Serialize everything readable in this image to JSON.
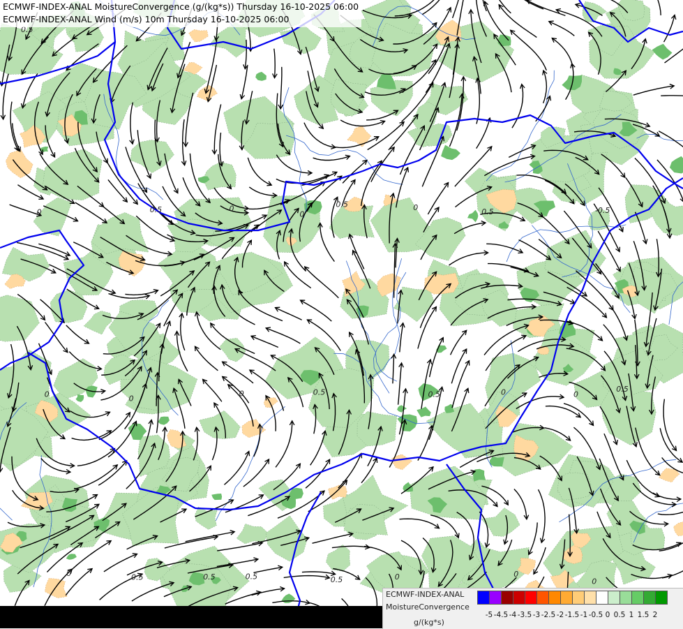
{
  "titles": {
    "line1": "ECMWF-INDEX-ANAL MoistureConvergence (g/(kg*s)) Thursday 16-10-2025 06:00",
    "line2": "ECMWF-INDEX-ANAL Wind (m/s) 10m Thursday 16-10-2025 06:00"
  },
  "legend": {
    "model": "ECMWF-INDEX-ANAL",
    "parameter": "MoistureConvergence",
    "unit": "g/(kg*s)",
    "swatch_colors": [
      "#0000ff",
      "#9900ff",
      "#990000",
      "#cc0000",
      "#ff0000",
      "#ff5500",
      "#ff8800",
      "#ffaa33",
      "#ffcc77",
      "#ffe0aa",
      "#ffffff",
      "#cceecc",
      "#99dd99",
      "#66cc66",
      "#33aa33",
      "#009900"
    ],
    "tick_labels": [
      "-5",
      "-4.5",
      "-4",
      "-3.5",
      "-3",
      "-2.5",
      "-2",
      "-1.5",
      "-1",
      "-0.5",
      "0",
      "0.5",
      "1",
      "1.5",
      "2"
    ]
  },
  "map": {
    "contour_labels": [
      "0.5",
      "0",
      "0",
      "0.5",
      "0.5",
      "0",
      "0",
      "0",
      "0.5",
      "0",
      "0",
      "0",
      "0.5",
      "0",
      "0",
      "0.5",
      "-0.5",
      "0",
      "0",
      "0.5",
      "0.5",
      "0",
      "0.5",
      "0.5",
      "0.5"
    ],
    "colors": {
      "border": "#0000ee",
      "river": "#3366cc",
      "green": "#b8e0b0",
      "orange": "#ffd9a0",
      "streamline": "#000000"
    }
  }
}
